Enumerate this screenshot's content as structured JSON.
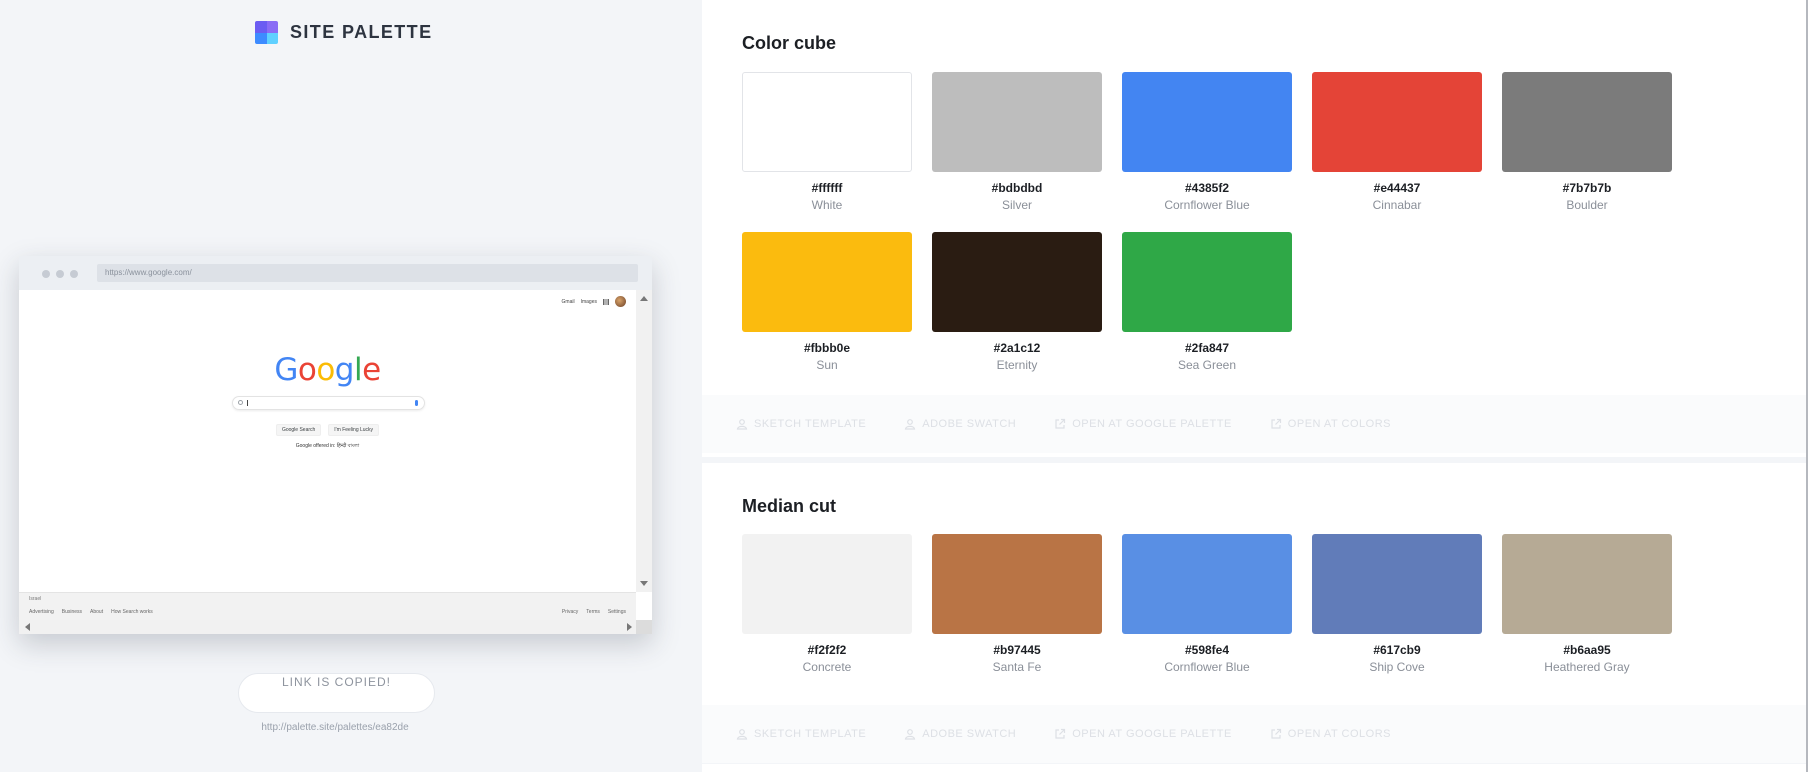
{
  "brand": {
    "name": "SITE PALETTE",
    "logo_colors": [
      "#6b5cf2",
      "#4da3f5",
      "#3d8bff",
      "#5fd0ff"
    ]
  },
  "preview": {
    "url": "https://www.google.com/",
    "google": {
      "top_links": [
        "Gmail",
        "Images"
      ],
      "logo_letters": [
        "G",
        "o",
        "o",
        "g",
        "l",
        "e"
      ],
      "buttons": [
        "Google Search",
        "I'm Feeling Lucky"
      ],
      "offered_in": "Google offered in: हिन्दी  বাংলা",
      "country": "Israel",
      "footer_left": [
        "Advertising",
        "Business",
        "About",
        "How Search works"
      ],
      "footer_right": [
        "Privacy",
        "Terms",
        "Settings"
      ]
    }
  },
  "copy": {
    "status": "LINK IS COPIED!",
    "link": "http://palette.site/palettes/ea82de"
  },
  "palettes": [
    {
      "title": "Color cube",
      "swatches": [
        {
          "hex": "#ffffff",
          "name": "White"
        },
        {
          "hex": "#bdbdbd",
          "name": "Silver"
        },
        {
          "hex": "#4385f2",
          "name": "Cornflower Blue"
        },
        {
          "hex": "#e44437",
          "name": "Cinnabar"
        },
        {
          "hex": "#7b7b7b",
          "name": "Boulder"
        },
        {
          "hex": "#fbbb0e",
          "name": "Sun"
        },
        {
          "hex": "#2a1c12",
          "name": "Eternity"
        },
        {
          "hex": "#2fa847",
          "name": "Sea Green"
        }
      ],
      "actions": [
        "SKETCH TEMPLATE",
        "ADOBE SWATCH",
        "OPEN AT GOOGLE PALETTE",
        "OPEN AT COLORS"
      ]
    },
    {
      "title": "Median cut",
      "swatches": [
        {
          "hex": "#f2f2f2",
          "name": "Concrete"
        },
        {
          "hex": "#b97445",
          "name": "Santa Fe"
        },
        {
          "hex": "#598fe4",
          "name": "Cornflower Blue"
        },
        {
          "hex": "#617cb9",
          "name": "Ship Cove"
        },
        {
          "hex": "#b6aa95",
          "name": "Heathered Gray"
        }
      ],
      "actions": [
        "SKETCH TEMPLATE",
        "ADOBE SWATCH",
        "OPEN AT GOOGLE PALETTE",
        "OPEN AT COLORS"
      ]
    }
  ]
}
